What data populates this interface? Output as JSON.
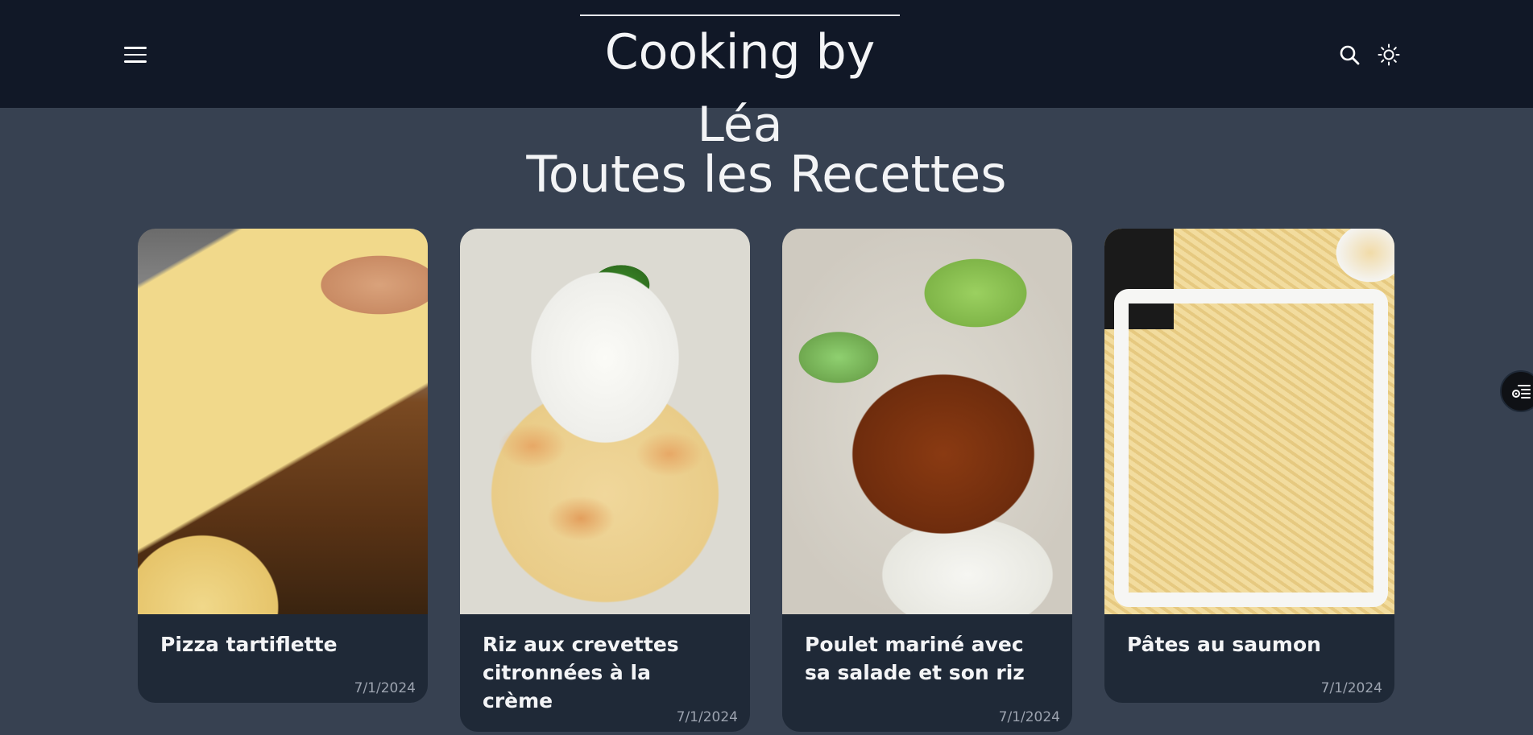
{
  "header": {
    "site_title": "Cooking by Léa",
    "menu_icon": "hamburger-menu-icon",
    "search_icon": "search-icon",
    "theme_icon": "sun-icon"
  },
  "main": {
    "heading": "Toutes les Recettes",
    "recipes": [
      {
        "title": "Pizza tartiflette",
        "date": "7/1/2024"
      },
      {
        "title": "Riz aux crevettes citronnées à la crème",
        "date": "7/1/2024"
      },
      {
        "title": "Poulet mariné avec sa salade et son riz",
        "date": "7/1/2024"
      },
      {
        "title": "Pâtes au saumon",
        "date": "7/1/2024"
      }
    ]
  },
  "side_button": {
    "icon": "filter-list-icon"
  },
  "colors": {
    "header_bg": "#111827",
    "page_bg": "#374151",
    "card_bg": "#1f2937",
    "date_text": "#9ca3af"
  }
}
